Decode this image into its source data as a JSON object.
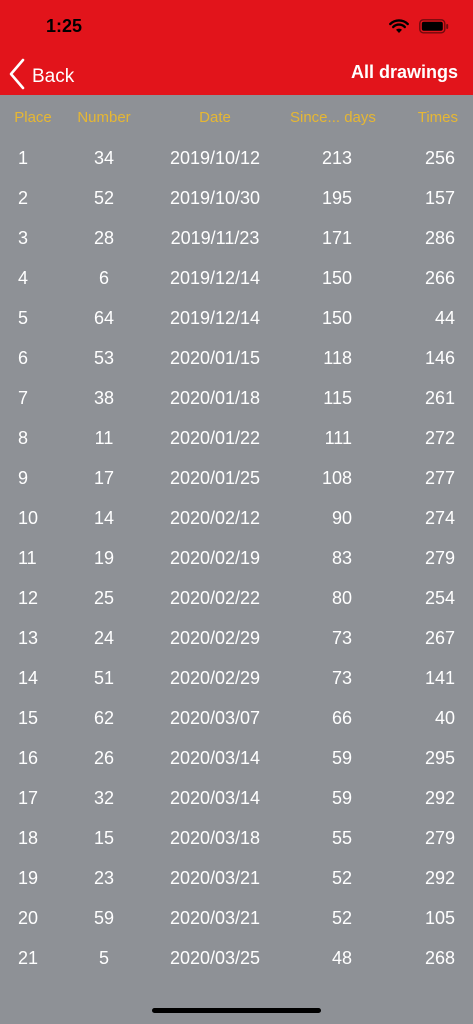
{
  "status_bar": {
    "time": "1:25"
  },
  "nav": {
    "back_label": "Back",
    "title": "All drawings"
  },
  "table": {
    "columns": [
      "Place",
      "Number",
      "Date",
      "Since... days",
      "Times"
    ],
    "rows": [
      [
        "1",
        "34",
        "2019/10/12",
        "213",
        "256"
      ],
      [
        "2",
        "52",
        "2019/10/30",
        "195",
        "157"
      ],
      [
        "3",
        "28",
        "2019/11/23",
        "171",
        "286"
      ],
      [
        "4",
        "6",
        "2019/12/14",
        "150",
        "266"
      ],
      [
        "5",
        "64",
        "2019/12/14",
        "150",
        "44"
      ],
      [
        "6",
        "53",
        "2020/01/15",
        "118",
        "146"
      ],
      [
        "7",
        "38",
        "2020/01/18",
        "115",
        "261"
      ],
      [
        "8",
        "11",
        "2020/01/22",
        "111",
        "272"
      ],
      [
        "9",
        "17",
        "2020/01/25",
        "108",
        "277"
      ],
      [
        "10",
        "14",
        "2020/02/12",
        "90",
        "274"
      ],
      [
        "11",
        "19",
        "2020/02/19",
        "83",
        "279"
      ],
      [
        "12",
        "25",
        "2020/02/22",
        "80",
        "254"
      ],
      [
        "13",
        "24",
        "2020/02/29",
        "73",
        "267"
      ],
      [
        "14",
        "51",
        "2020/02/29",
        "73",
        "141"
      ],
      [
        "15",
        "62",
        "2020/03/07",
        "66",
        "40"
      ],
      [
        "16",
        "26",
        "2020/03/14",
        "59",
        "295"
      ],
      [
        "17",
        "32",
        "2020/03/14",
        "59",
        "292"
      ],
      [
        "18",
        "15",
        "2020/03/18",
        "55",
        "279"
      ],
      [
        "19",
        "23",
        "2020/03/21",
        "52",
        "292"
      ],
      [
        "20",
        "59",
        "2020/03/21",
        "52",
        "105"
      ],
      [
        "21",
        "5",
        "2020/03/25",
        "48",
        "268"
      ]
    ]
  },
  "colors": {
    "header_bg": "#e2141b",
    "page_bg": "#8e9196",
    "column_header": "#e6b733",
    "cell_text": "#ffffff"
  },
  "icons": {
    "back": "chevron-left-icon",
    "wifi": "wifi-icon",
    "battery": "battery-icon"
  }
}
